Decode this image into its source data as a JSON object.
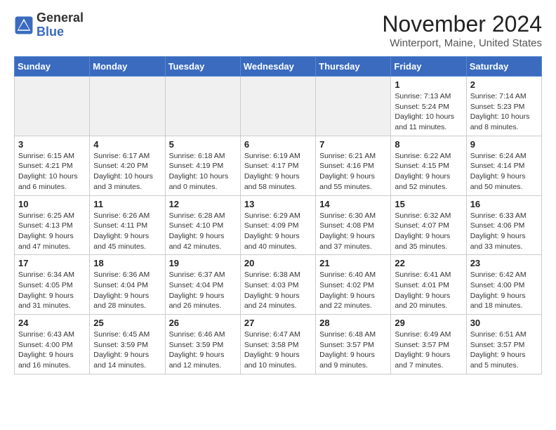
{
  "header": {
    "logo_general": "General",
    "logo_blue": "Blue",
    "month_title": "November 2024",
    "location": "Winterport, Maine, United States"
  },
  "days_of_week": [
    "Sunday",
    "Monday",
    "Tuesday",
    "Wednesday",
    "Thursday",
    "Friday",
    "Saturday"
  ],
  "weeks": [
    [
      {
        "day": "",
        "info": ""
      },
      {
        "day": "",
        "info": ""
      },
      {
        "day": "",
        "info": ""
      },
      {
        "day": "",
        "info": ""
      },
      {
        "day": "",
        "info": ""
      },
      {
        "day": "1",
        "info": "Sunrise: 7:13 AM\nSunset: 5:24 PM\nDaylight: 10 hours and 11 minutes."
      },
      {
        "day": "2",
        "info": "Sunrise: 7:14 AM\nSunset: 5:23 PM\nDaylight: 10 hours and 8 minutes."
      }
    ],
    [
      {
        "day": "3",
        "info": "Sunrise: 6:15 AM\nSunset: 4:21 PM\nDaylight: 10 hours and 6 minutes."
      },
      {
        "day": "4",
        "info": "Sunrise: 6:17 AM\nSunset: 4:20 PM\nDaylight: 10 hours and 3 minutes."
      },
      {
        "day": "5",
        "info": "Sunrise: 6:18 AM\nSunset: 4:19 PM\nDaylight: 10 hours and 0 minutes."
      },
      {
        "day": "6",
        "info": "Sunrise: 6:19 AM\nSunset: 4:17 PM\nDaylight: 9 hours and 58 minutes."
      },
      {
        "day": "7",
        "info": "Sunrise: 6:21 AM\nSunset: 4:16 PM\nDaylight: 9 hours and 55 minutes."
      },
      {
        "day": "8",
        "info": "Sunrise: 6:22 AM\nSunset: 4:15 PM\nDaylight: 9 hours and 52 minutes."
      },
      {
        "day": "9",
        "info": "Sunrise: 6:24 AM\nSunset: 4:14 PM\nDaylight: 9 hours and 50 minutes."
      }
    ],
    [
      {
        "day": "10",
        "info": "Sunrise: 6:25 AM\nSunset: 4:13 PM\nDaylight: 9 hours and 47 minutes."
      },
      {
        "day": "11",
        "info": "Sunrise: 6:26 AM\nSunset: 4:11 PM\nDaylight: 9 hours and 45 minutes."
      },
      {
        "day": "12",
        "info": "Sunrise: 6:28 AM\nSunset: 4:10 PM\nDaylight: 9 hours and 42 minutes."
      },
      {
        "day": "13",
        "info": "Sunrise: 6:29 AM\nSunset: 4:09 PM\nDaylight: 9 hours and 40 minutes."
      },
      {
        "day": "14",
        "info": "Sunrise: 6:30 AM\nSunset: 4:08 PM\nDaylight: 9 hours and 37 minutes."
      },
      {
        "day": "15",
        "info": "Sunrise: 6:32 AM\nSunset: 4:07 PM\nDaylight: 9 hours and 35 minutes."
      },
      {
        "day": "16",
        "info": "Sunrise: 6:33 AM\nSunset: 4:06 PM\nDaylight: 9 hours and 33 minutes."
      }
    ],
    [
      {
        "day": "17",
        "info": "Sunrise: 6:34 AM\nSunset: 4:05 PM\nDaylight: 9 hours and 31 minutes."
      },
      {
        "day": "18",
        "info": "Sunrise: 6:36 AM\nSunset: 4:04 PM\nDaylight: 9 hours and 28 minutes."
      },
      {
        "day": "19",
        "info": "Sunrise: 6:37 AM\nSunset: 4:04 PM\nDaylight: 9 hours and 26 minutes."
      },
      {
        "day": "20",
        "info": "Sunrise: 6:38 AM\nSunset: 4:03 PM\nDaylight: 9 hours and 24 minutes."
      },
      {
        "day": "21",
        "info": "Sunrise: 6:40 AM\nSunset: 4:02 PM\nDaylight: 9 hours and 22 minutes."
      },
      {
        "day": "22",
        "info": "Sunrise: 6:41 AM\nSunset: 4:01 PM\nDaylight: 9 hours and 20 minutes."
      },
      {
        "day": "23",
        "info": "Sunrise: 6:42 AM\nSunset: 4:00 PM\nDaylight: 9 hours and 18 minutes."
      }
    ],
    [
      {
        "day": "24",
        "info": "Sunrise: 6:43 AM\nSunset: 4:00 PM\nDaylight: 9 hours and 16 minutes."
      },
      {
        "day": "25",
        "info": "Sunrise: 6:45 AM\nSunset: 3:59 PM\nDaylight: 9 hours and 14 minutes."
      },
      {
        "day": "26",
        "info": "Sunrise: 6:46 AM\nSunset: 3:59 PM\nDaylight: 9 hours and 12 minutes."
      },
      {
        "day": "27",
        "info": "Sunrise: 6:47 AM\nSunset: 3:58 PM\nDaylight: 9 hours and 10 minutes."
      },
      {
        "day": "28",
        "info": "Sunrise: 6:48 AM\nSunset: 3:57 PM\nDaylight: 9 hours and 9 minutes."
      },
      {
        "day": "29",
        "info": "Sunrise: 6:49 AM\nSunset: 3:57 PM\nDaylight: 9 hours and 7 minutes."
      },
      {
        "day": "30",
        "info": "Sunrise: 6:51 AM\nSunset: 3:57 PM\nDaylight: 9 hours and 5 minutes."
      }
    ]
  ]
}
